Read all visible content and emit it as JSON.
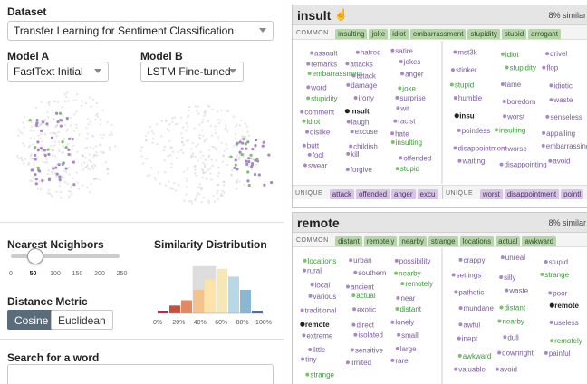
{
  "left": {
    "dataset_label": "Dataset",
    "dataset_value": "Transfer Learning for Sentiment Classification",
    "model_a_label": "Model A",
    "model_a_value": "FastText Initial",
    "model_b_label": "Model B",
    "model_b_value": "LSTM Fine-tuned",
    "nn_label": "Nearest Neighbors",
    "nn_ticks": [
      "0",
      "50",
      "100",
      "150",
      "200",
      "250"
    ],
    "nn_value": 50,
    "sim_label": "Similarity Distribution",
    "sim_ticks": [
      "0%",
      "20%",
      "40%",
      "60%",
      "80%",
      "100%"
    ],
    "distance_label": "Distance Metric",
    "distance_options": [
      "Cosine",
      "Euclidean"
    ],
    "distance_selected": "Cosine",
    "search_label": "Search for a word",
    "search_value": ""
  },
  "histogram": {
    "bins": [
      0.05,
      0.15,
      0.25,
      0.45,
      0.65,
      0.85,
      0.7,
      0.45,
      0.05
    ],
    "colors": [
      "#a5162b",
      "#c7503c",
      "#e08a63",
      "#f2c38d",
      "#fbe3a9",
      "#f5e7b8",
      "#b8d8e8",
      "#8bb7d3",
      "#3b5d9e"
    ],
    "highlight": [
      0.33,
      0.55
    ]
  },
  "cards": [
    {
      "title": "insult",
      "similarity": "8% similar",
      "common_label": "COMMON",
      "common": [
        "insulting",
        "joke",
        "idiot",
        "embarrassment",
        "stupidity",
        "stupid",
        "arrogant"
      ],
      "unique_label": "UNIQUE",
      "unique_a": [
        "attack",
        "offended",
        "anger",
        "excu"
      ],
      "unique_b": [
        "worst",
        "disappointment",
        "pointl"
      ],
      "words_a": [
        {
          "w": "assault",
          "c": "p"
        },
        {
          "w": "hatred",
          "c": "p"
        },
        {
          "w": "satire",
          "c": "p"
        },
        {
          "w": "remarks",
          "c": "p"
        },
        {
          "w": "attacks",
          "c": "p"
        },
        {
          "w": "jokes",
          "c": "p"
        },
        {
          "w": "embarrassment",
          "c": "g"
        },
        {
          "w": "attack",
          "c": "p"
        },
        {
          "w": "anger",
          "c": "p"
        },
        {
          "w": "word",
          "c": "p"
        },
        {
          "w": "damage",
          "c": "p"
        },
        {
          "w": "joke",
          "c": "g"
        },
        {
          "w": "stupidity",
          "c": "g"
        },
        {
          "w": "irony",
          "c": "p"
        },
        {
          "w": "surprise",
          "c": "p"
        },
        {
          "w": "comment",
          "c": "p"
        },
        {
          "w": "insult",
          "c": "k"
        },
        {
          "w": "wit",
          "c": "p"
        },
        {
          "w": "idiot",
          "c": "g"
        },
        {
          "w": "laugh",
          "c": "p"
        },
        {
          "w": "racist",
          "c": "p"
        },
        {
          "w": "dislike",
          "c": "p"
        },
        {
          "w": "excuse",
          "c": "p"
        },
        {
          "w": "hate",
          "c": "p"
        },
        {
          "w": "butt",
          "c": "p"
        },
        {
          "w": "childish",
          "c": "p"
        },
        {
          "w": "insulting",
          "c": "g"
        },
        {
          "w": "fool",
          "c": "p"
        },
        {
          "w": "kill",
          "c": "p"
        },
        {
          "w": "offended",
          "c": "p"
        },
        {
          "w": "swear",
          "c": "p"
        },
        {
          "w": "forgive",
          "c": "p"
        },
        {
          "w": "stupid",
          "c": "g"
        }
      ],
      "words_b": [
        {
          "w": "mst3k",
          "c": "p"
        },
        {
          "w": "idiot",
          "c": "g"
        },
        {
          "w": "drivel",
          "c": "p"
        },
        {
          "w": "stinker",
          "c": "p"
        },
        {
          "w": "stupidity",
          "c": "g"
        },
        {
          "w": "flop",
          "c": "p"
        },
        {
          "w": "stupid",
          "c": "g"
        },
        {
          "w": "lame",
          "c": "p"
        },
        {
          "w": "idiotic",
          "c": "p"
        },
        {
          "w": "humble",
          "c": "p"
        },
        {
          "w": "boredom",
          "c": "p"
        },
        {
          "w": "waste",
          "c": "p"
        },
        {
          "w": "insu",
          "c": "k"
        },
        {
          "w": "worst",
          "c": "p"
        },
        {
          "w": "senseless",
          "c": "p"
        },
        {
          "w": "pointless",
          "c": "p"
        },
        {
          "w": "insulting",
          "c": "g"
        },
        {
          "w": "appalling",
          "c": "p"
        },
        {
          "w": "disappointment",
          "c": "p"
        },
        {
          "w": "worse",
          "c": "p"
        },
        {
          "w": "embarrassing",
          "c": "p"
        },
        {
          "w": "waiting",
          "c": "p"
        },
        {
          "w": "disappointing",
          "c": "p"
        },
        {
          "w": "avoid",
          "c": "p"
        }
      ]
    },
    {
      "title": "remote",
      "similarity": "8% similar",
      "common_label": "COMMON",
      "common": [
        "distant",
        "remotely",
        "nearby",
        "strange",
        "locations",
        "actual",
        "awkward"
      ],
      "words_a": [
        {
          "w": "locations",
          "c": "g"
        },
        {
          "w": "urban",
          "c": "p"
        },
        {
          "w": "possibility",
          "c": "p"
        },
        {
          "w": "rural",
          "c": "p"
        },
        {
          "w": "southern",
          "c": "p"
        },
        {
          "w": "nearby",
          "c": "g"
        },
        {
          "w": "local",
          "c": "p"
        },
        {
          "w": "ancient",
          "c": "p"
        },
        {
          "w": "remotely",
          "c": "g"
        },
        {
          "w": "various",
          "c": "p"
        },
        {
          "w": "actual",
          "c": "g"
        },
        {
          "w": "near",
          "c": "p"
        },
        {
          "w": "traditional",
          "c": "p"
        },
        {
          "w": "exotic",
          "c": "p"
        },
        {
          "w": "distant",
          "c": "g"
        },
        {
          "w": "remote",
          "c": "k"
        },
        {
          "w": "direct",
          "c": "p"
        },
        {
          "w": "lonely",
          "c": "p"
        },
        {
          "w": "extreme",
          "c": "p"
        },
        {
          "w": "isolated",
          "c": "p"
        },
        {
          "w": "small",
          "c": "p"
        },
        {
          "w": "little",
          "c": "p"
        },
        {
          "w": "sensitive",
          "c": "p"
        },
        {
          "w": "large",
          "c": "p"
        },
        {
          "w": "tiny",
          "c": "p"
        },
        {
          "w": "limited",
          "c": "p"
        },
        {
          "w": "rare",
          "c": "p"
        },
        {
          "w": "strange",
          "c": "g"
        }
      ],
      "words_b": [
        {
          "w": "crappy",
          "c": "p"
        },
        {
          "w": "unreal",
          "c": "p"
        },
        {
          "w": "stupid",
          "c": "p"
        },
        {
          "w": "settings",
          "c": "p"
        },
        {
          "w": "silly",
          "c": "p"
        },
        {
          "w": "strange",
          "c": "g"
        },
        {
          "w": "pathetic",
          "c": "p"
        },
        {
          "w": "waste",
          "c": "p"
        },
        {
          "w": "poor",
          "c": "p"
        },
        {
          "w": "mundane",
          "c": "p"
        },
        {
          "w": "distant",
          "c": "g"
        },
        {
          "w": "remote",
          "c": "k"
        },
        {
          "w": "awful",
          "c": "p"
        },
        {
          "w": "nearby",
          "c": "g"
        },
        {
          "w": "useless",
          "c": "p"
        },
        {
          "w": "inept",
          "c": "p"
        },
        {
          "w": "dull",
          "c": "p"
        },
        {
          "w": "remotely",
          "c": "g"
        },
        {
          "w": "awkward",
          "c": "g"
        },
        {
          "w": "downright",
          "c": "p"
        },
        {
          "w": "painful",
          "c": "p"
        },
        {
          "w": "valuable",
          "c": "p"
        },
        {
          "w": "avoid",
          "c": "p"
        }
      ]
    }
  ],
  "colors": {
    "green": "#7cc26a",
    "purple": "#a887c8",
    "key": "#222222",
    "green_text": "#3a9a3a",
    "purple_text": "#7a5a9a"
  }
}
